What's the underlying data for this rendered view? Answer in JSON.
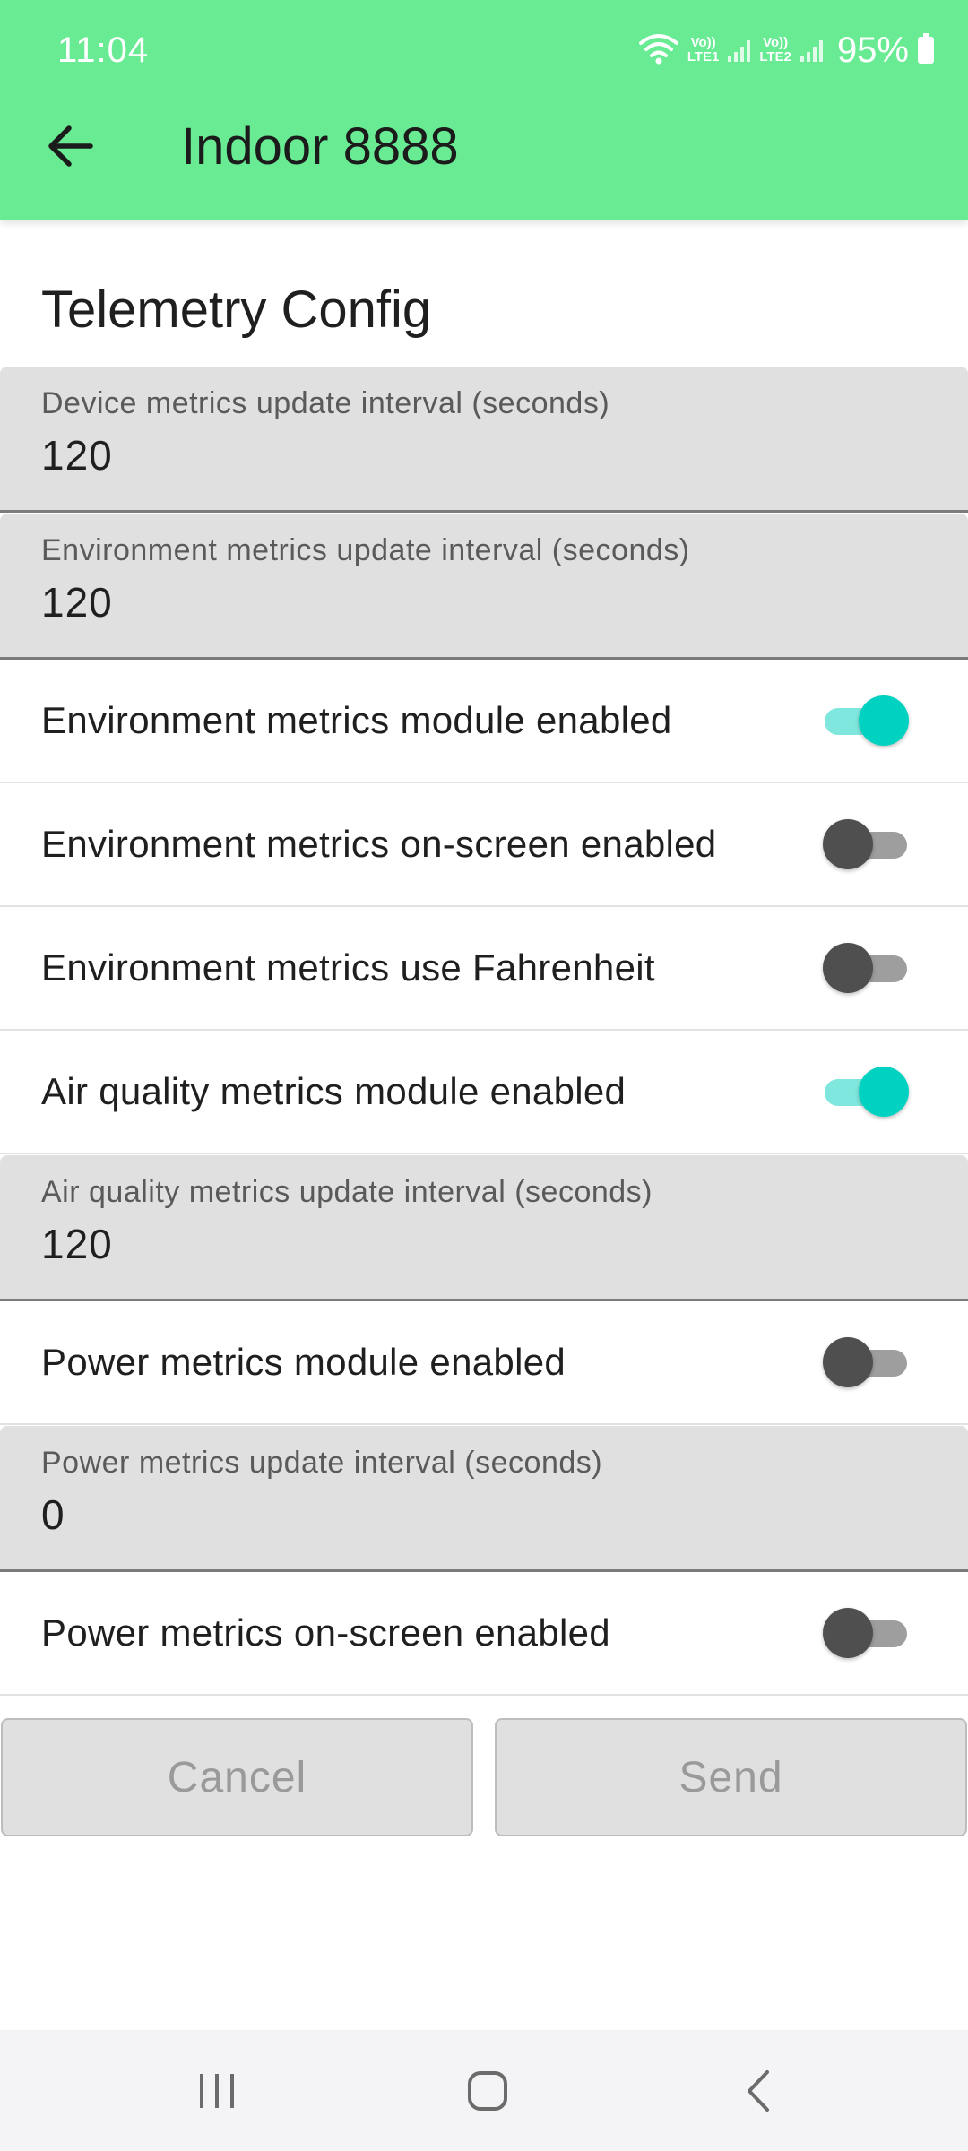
{
  "status_bar": {
    "time": "11:04",
    "sim1_label": "Vo))\nLTE1",
    "sim2_label": "Vo))\nLTE2",
    "battery": "95%"
  },
  "app_bar": {
    "title": "Indoor 8888",
    "back_icon": "arrow-back-icon"
  },
  "section": {
    "title": "Telemetry Config"
  },
  "fields": {
    "device_interval": {
      "label": "Device metrics update interval (seconds)",
      "value": "120"
    },
    "env_interval": {
      "label": "Environment metrics update interval (seconds)",
      "value": "120"
    },
    "air_interval": {
      "label": "Air quality metrics update interval (seconds)",
      "value": "120"
    },
    "power_interval": {
      "label": "Power metrics update interval (seconds)",
      "value": "0"
    }
  },
  "toggles": {
    "env_module": {
      "label": "Environment metrics module enabled",
      "on": true
    },
    "env_screen": {
      "label": "Environment metrics on-screen enabled",
      "on": false
    },
    "env_fahrenheit": {
      "label": "Environment metrics use Fahrenheit",
      "on": false
    },
    "air_module": {
      "label": "Air quality metrics module enabled",
      "on": true
    },
    "power_module": {
      "label": "Power metrics module enabled",
      "on": false
    },
    "power_screen": {
      "label": "Power metrics on-screen enabled",
      "on": false
    }
  },
  "buttons": {
    "cancel": "Cancel",
    "send": "Send"
  },
  "colors": {
    "header": "#69EB94",
    "switch_on": "#00D2C1",
    "field_bg": "#E0E0E0"
  }
}
